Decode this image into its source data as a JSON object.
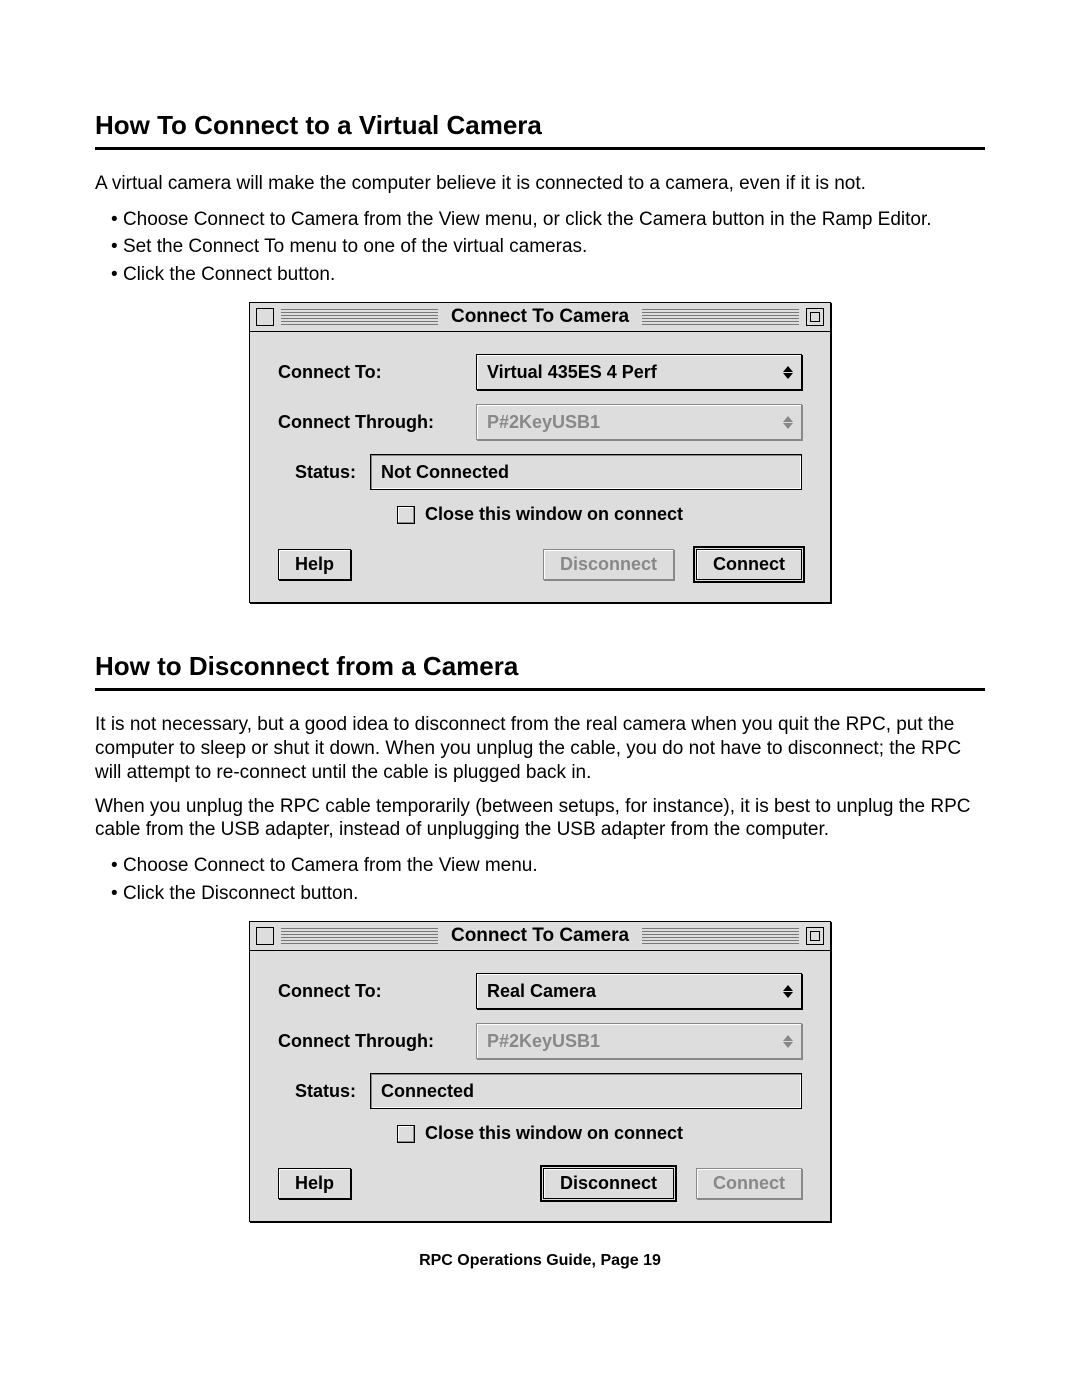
{
  "section1": {
    "heading": "How To Connect to a Virtual Camera",
    "intro": "A virtual camera will make the computer believe it is connected to a camera, even if it is not.",
    "bullets": [
      "Choose Connect to Camera from the View menu, or click the Camera button in the Ramp Editor.",
      "Set the Connect To menu to one of the virtual cameras.",
      "Click the Connect button."
    ]
  },
  "dialog1": {
    "title": "Connect To Camera",
    "labels": {
      "connect_to": "Connect To:",
      "connect_through": "Connect Through:",
      "status": "Status:"
    },
    "connect_to_value": "Virtual 435ES 4 Perf",
    "connect_through_value": "P#2KeyUSB1",
    "status_value": "Not Connected",
    "checkbox_label": "Close this window on connect",
    "buttons": {
      "help": "Help",
      "disconnect": "Disconnect",
      "connect": "Connect"
    },
    "default_button": "connect",
    "disconnect_disabled": true,
    "connect_through_disabled": true
  },
  "section2": {
    "heading": "How to Disconnect from a Camera",
    "para1": "It is not necessary, but a good idea to disconnect from the real camera when you quit the RPC, put the computer to sleep or shut it down. When you unplug the cable, you do not have to disconnect; the RPC will attempt to re-connect until the cable is plugged back in.",
    "para2": "When you unplug the RPC cable temporarily (between setups, for instance), it is best to unplug the RPC cable from the USB adapter, instead of unplugging the USB adapter from the computer.",
    "bullets": [
      "Choose Connect to Camera from the View menu.",
      "Click the Disconnect button."
    ]
  },
  "dialog2": {
    "title": "Connect To Camera",
    "labels": {
      "connect_to": "Connect To:",
      "connect_through": "Connect Through:",
      "status": "Status:"
    },
    "connect_to_value": "Real Camera",
    "connect_through_value": "P#2KeyUSB1",
    "status_value": "Connected",
    "checkbox_label": "Close this window on connect",
    "buttons": {
      "help": "Help",
      "disconnect": "Disconnect",
      "connect": "Connect"
    },
    "default_button": "disconnect",
    "connect_disabled": true,
    "connect_through_disabled": true
  },
  "footer": "RPC Operations Guide, Page 19"
}
